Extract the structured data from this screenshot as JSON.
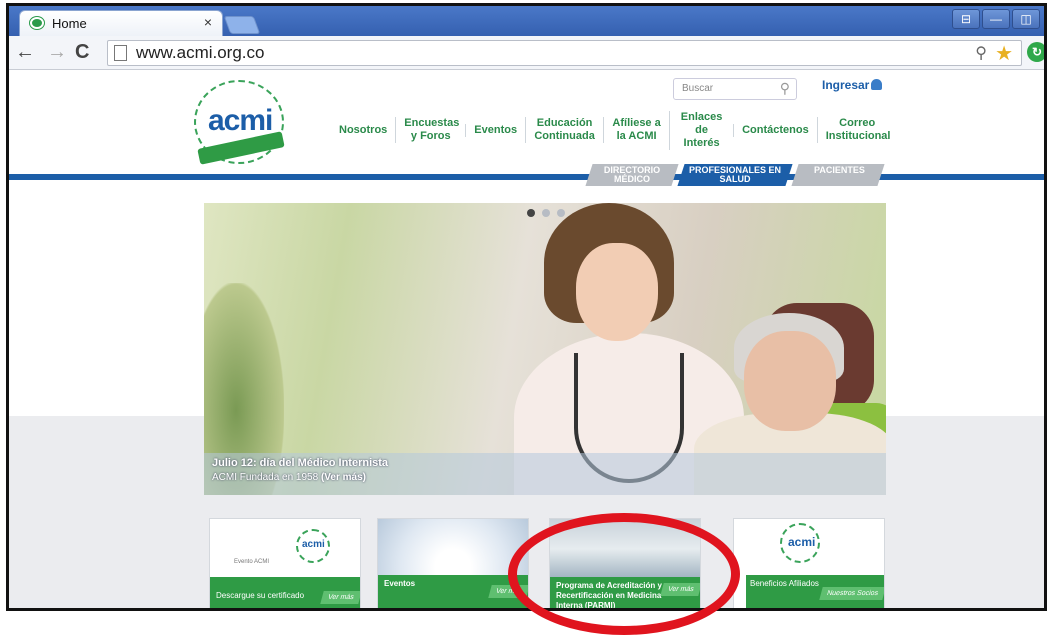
{
  "browser": {
    "tab_title": "Home",
    "tab_close": "×",
    "url": "www.acmi.org.co",
    "window_buttons": [
      "⊟",
      "—",
      "◫"
    ]
  },
  "header": {
    "logo_text": "acmi",
    "search_placeholder": "Buscar",
    "login_label": "Ingresar",
    "nav": [
      {
        "label": "Nosotros"
      },
      {
        "label": "Encuestas y Foros"
      },
      {
        "label": "Eventos"
      },
      {
        "label": "Educación Continuada"
      },
      {
        "label": "Afíliese a la ACMI"
      },
      {
        "label": "Enlaces de Interés"
      },
      {
        "label": "Contáctenos"
      },
      {
        "label": "Correo Institucional"
      }
    ],
    "subnav": [
      {
        "label": "DIRECTORIO MÉDICO"
      },
      {
        "label": "PROFESIONALES EN SALUD"
      },
      {
        "label": "PACIENTES"
      }
    ]
  },
  "hero": {
    "caption_title": "Julio 12: día del Médico Internista",
    "caption_sub": "ACMI Fundada en 1958",
    "caption_link": "(Ver más)"
  },
  "cards": [
    {
      "text": "Descargue su certificado",
      "button": "Ver más",
      "logo": "acmi",
      "caption": "Evento ACMI"
    },
    {
      "text": "Eventos",
      "button": "Ver más"
    },
    {
      "text": "Programa de Acreditación y Recertificación en Medicina Interna (PARMI)",
      "button": "Ver más"
    },
    {
      "text": "Beneficios Afiliados",
      "button": "Nuestros Socios",
      "logo": "acmi"
    }
  ],
  "colors": {
    "brand_blue": "#1c5ea8",
    "brand_green": "#2f9b45",
    "highlight_red": "#e0141e"
  }
}
